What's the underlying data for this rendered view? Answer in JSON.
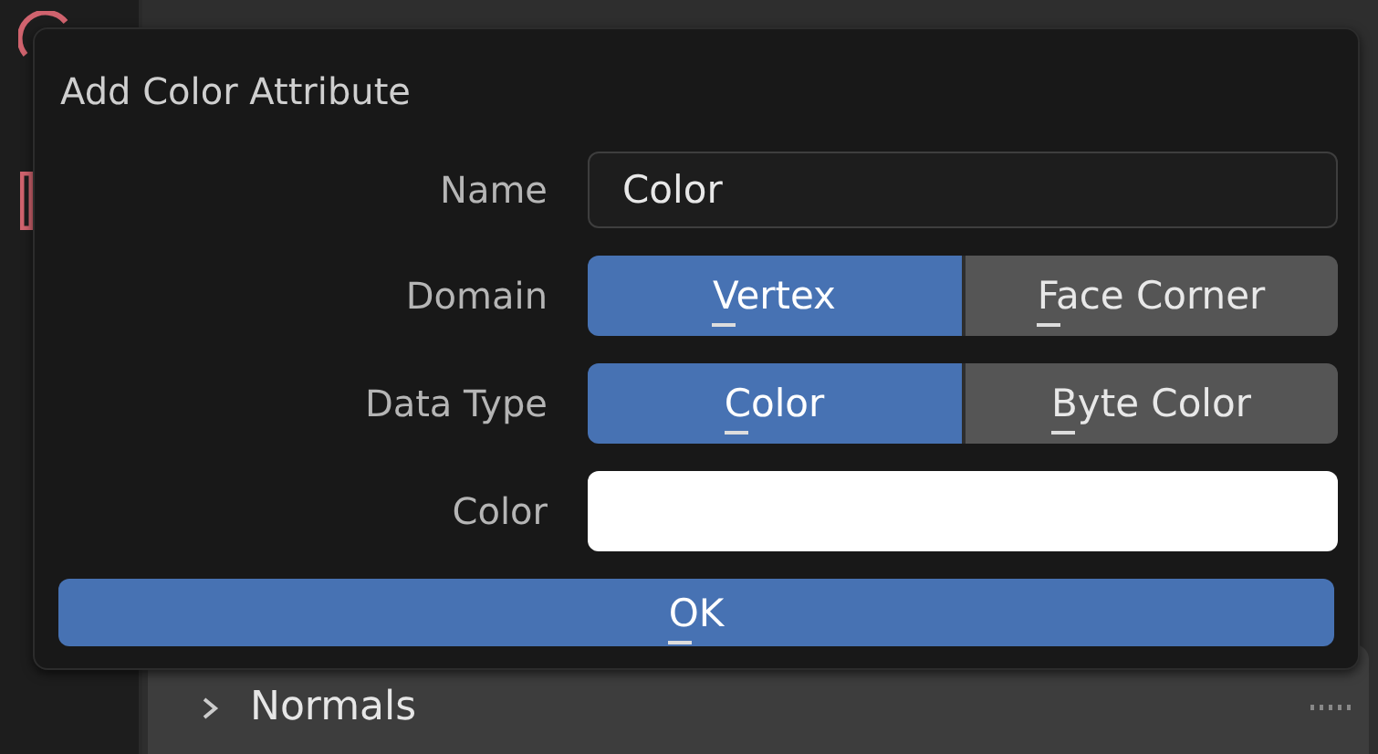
{
  "dialog": {
    "title": "Add Color Attribute",
    "fields": [
      {
        "kind": "text",
        "label": "Name",
        "value": "Color"
      },
      {
        "kind": "choice",
        "label": "Domain",
        "options": [
          {
            "label": "Vertex",
            "selected": true
          },
          {
            "label": "Face Corner",
            "selected": false
          }
        ]
      },
      {
        "kind": "choice",
        "label": "Data Type",
        "options": [
          {
            "label": "Color",
            "selected": true
          },
          {
            "label": "Byte Color",
            "selected": false
          }
        ]
      },
      {
        "kind": "color",
        "label": "Color",
        "color": "#ffffff"
      }
    ],
    "ok_button": "OK"
  },
  "background_panel": {
    "items": [
      {
        "label": "Normals",
        "expanded": false
      }
    ]
  }
}
